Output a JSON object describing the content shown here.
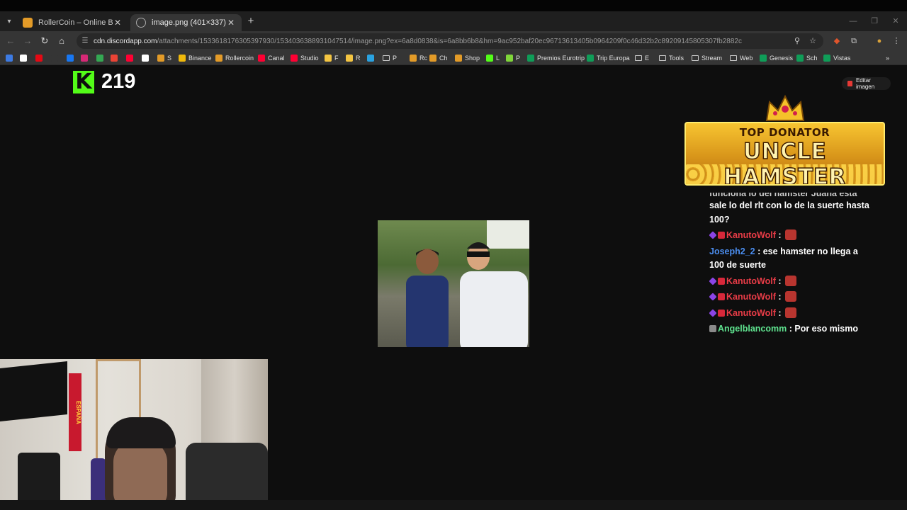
{
  "browser": {
    "tabs": [
      {
        "title": "RollerCoin – Online Bitcoin Mi",
        "active": false,
        "favicon_color": "#e39b28"
      },
      {
        "title": "image.png (401×337)",
        "active": true,
        "favicon_color": "#8a8a8a"
      }
    ],
    "new_tab_icon": "plus-icon",
    "url_host": "cdn.discordapp.com",
    "url_path": "/attachments/1533618176305397930/1534036388931047514/image.png?ex=6a8d0838&is=6a8bb6b8&hm=9ac952baf20ec96713613405b0964209f0c46d32b2c89209145805307fb2882c",
    "bookmarks": [
      {
        "label": "",
        "color": "#3d7be3"
      },
      {
        "label": "",
        "color": "#ffffff"
      },
      {
        "label": "",
        "color": "#e50914"
      },
      {
        "label": "",
        "color": "#353535"
      },
      {
        "label": "",
        "color": "#1877f2"
      },
      {
        "label": "",
        "color": "#d62976"
      },
      {
        "label": "",
        "color": "#34a853"
      },
      {
        "label": "",
        "color": "#ea4335"
      },
      {
        "label": "",
        "color": "#ff0033"
      },
      {
        "label": "",
        "color": "#ffffff"
      },
      {
        "label": "S",
        "color": "#e39b28"
      },
      {
        "label": "Binance",
        "color": "#f0b90b"
      },
      {
        "label": "Rollercoin",
        "color": "#e39b28"
      },
      {
        "label": "Canal",
        "color": "#ff0033"
      },
      {
        "label": "Studio",
        "color": "#ff0033"
      },
      {
        "label": "F",
        "color": "#f4c542"
      },
      {
        "label": "R",
        "color": "#f4c542"
      },
      {
        "label": "",
        "color": "#2aa2e0"
      },
      {
        "label": "P",
        "folder": true
      },
      {
        "label": "Rc",
        "color": "#e39b28"
      },
      {
        "label": "Ch",
        "color": "#e39b28"
      },
      {
        "label": "Shop",
        "color": "#e39b28"
      },
      {
        "label": "L",
        "color": "#53fc18"
      },
      {
        "label": "P",
        "color": "#7fd63a"
      },
      {
        "label": "Premios Eurotrip",
        "color": "#0f9d58"
      },
      {
        "label": "Trip Europa",
        "color": "#0f9d58"
      },
      {
        "label": "E",
        "folder": true
      },
      {
        "label": "Tools",
        "folder": true
      },
      {
        "label": "Stream",
        "folder": true
      },
      {
        "label": "Web",
        "folder": true
      },
      {
        "label": "Genesis",
        "color": "#0f9d58"
      },
      {
        "label": "Sch",
        "color": "#0f9d58"
      },
      {
        "label": "Vistas",
        "color": "#0f9d58"
      }
    ],
    "bookmarks_overflow": "»"
  },
  "overlay": {
    "kick_logo": "K",
    "viewer_count": "219",
    "edit_button_label": "Editar imagen",
    "donator_title": "TOP DONATOR",
    "donator_name": "UNCLE HAMSTER",
    "chat": [
      {
        "name": "",
        "text": "funciona lo del hamster Juana esta que",
        "cut": true
      },
      {
        "name": "",
        "text": "sale lo del rlt con lo de la suerte hasta 100?"
      },
      {
        "name": "KanutoWolf",
        "name_color": "red",
        "badges": [
          "purple",
          "red"
        ],
        "text": "",
        "emote": true
      },
      {
        "name": "Joseph2_2",
        "name_color": "blue",
        "badges": [],
        "text": "ese hamster no llega a 100 de suerte"
      },
      {
        "name": "KanutoWolf",
        "name_color": "red",
        "badges": [
          "purple",
          "red"
        ],
        "text": "",
        "emote": true
      },
      {
        "name": "KanutoWolf",
        "name_color": "red",
        "badges": [
          "purple",
          "red"
        ],
        "text": "",
        "emote": true
      },
      {
        "name": "KanutoWolf",
        "name_color": "red",
        "badges": [
          "purple",
          "red"
        ],
        "text": "",
        "emote": true
      },
      {
        "name": "Angelblancomm",
        "name_color": "green",
        "badges": [
          "gray"
        ],
        "text": "Por eso mismo"
      }
    ],
    "webcam_flag_text": "ESPAÑA"
  }
}
